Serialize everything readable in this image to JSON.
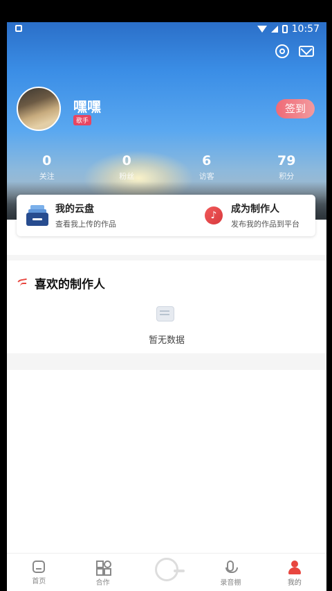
{
  "status_bar": {
    "time": "10:57"
  },
  "profile": {
    "name": "嘿嘿",
    "badge": "歌手",
    "checkin_label": "签到"
  },
  "stats": [
    {
      "value": "0",
      "label": "关注"
    },
    {
      "value": "0",
      "label": "粉丝"
    },
    {
      "value": "6",
      "label": "访客"
    },
    {
      "value": "79",
      "label": "积分"
    }
  ],
  "card": {
    "cloud": {
      "title": "我的云盘",
      "subtitle": "查看我上传的作品"
    },
    "creator": {
      "title": "成为制作人",
      "subtitle": "发布我的作品到平台"
    }
  },
  "favorites": {
    "title": "喜欢的制作人",
    "empty_text": "暂无数据"
  },
  "bottom_nav": [
    {
      "label": "首页",
      "icon": "home-icon"
    },
    {
      "label": "合作",
      "icon": "grid-icon"
    },
    {
      "label": "",
      "icon": "center-record-icon"
    },
    {
      "label": "录音棚",
      "icon": "microphone-icon"
    },
    {
      "label": "我的",
      "icon": "user-icon"
    }
  ],
  "colors": {
    "accent": "#e8463f",
    "checkin_gradient_start": "#f06a76",
    "checkin_gradient_end": "#f29a9e"
  }
}
